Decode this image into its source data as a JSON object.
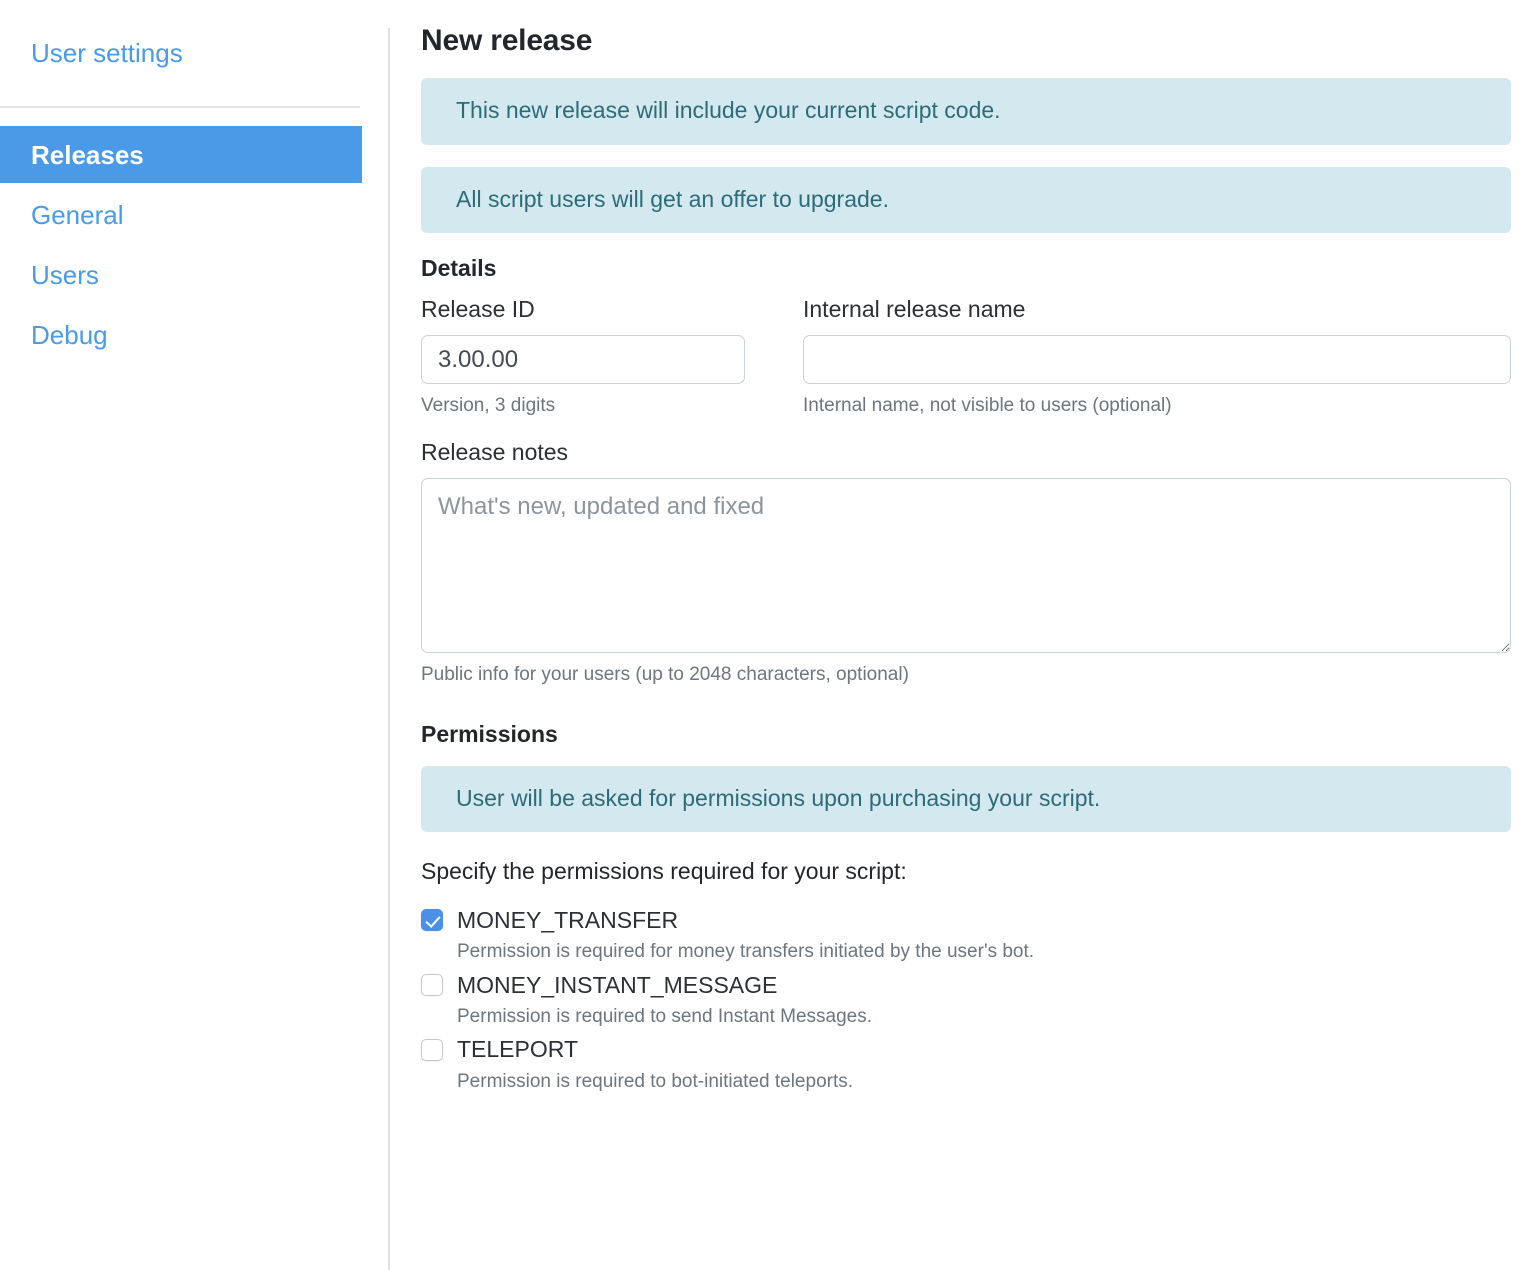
{
  "sidebar": {
    "title": "User settings",
    "items": [
      {
        "label": "Releases",
        "active": true
      },
      {
        "label": "General",
        "active": false
      },
      {
        "label": "Users",
        "active": false
      },
      {
        "label": "Debug",
        "active": false
      }
    ]
  },
  "main": {
    "page_title": "New release",
    "alerts": [
      "This new release will include your current script code.",
      "All script users will get an offer to upgrade."
    ],
    "details": {
      "heading": "Details",
      "release_id": {
        "label": "Release ID",
        "value": "3.00.00",
        "placeholder": "",
        "help": "Version, 3 digits"
      },
      "internal_name": {
        "label": "Internal release name",
        "value": "",
        "placeholder": "",
        "help": "Internal name, not visible to users (optional)"
      },
      "release_notes": {
        "label": "Release notes",
        "value": "",
        "placeholder": "What's new, updated and fixed",
        "help": "Public info for your users (up to 2048 characters, optional)"
      }
    },
    "permissions": {
      "heading": "Permissions",
      "alert": "User will be asked for permissions upon purchasing your script.",
      "instruction": "Specify the permissions required for your script:",
      "items": [
        {
          "name": "MONEY_TRANSFER",
          "description": "Permission is required for money transfers initiated by the user's bot.",
          "checked": true
        },
        {
          "name": "MONEY_INSTANT_MESSAGE",
          "description": "Permission is required to send Instant Messages.",
          "checked": false
        },
        {
          "name": "TELEPORT",
          "description": "Permission is required to bot-initiated teleports.",
          "checked": false
        }
      ]
    }
  },
  "colors": {
    "accent": "#4a9ae8",
    "alert_bg": "#d4e9ef",
    "alert_text": "#2c6b78",
    "heading": "#23272b",
    "help_text": "#6d757d",
    "input_border": "#ccd2d9"
  }
}
